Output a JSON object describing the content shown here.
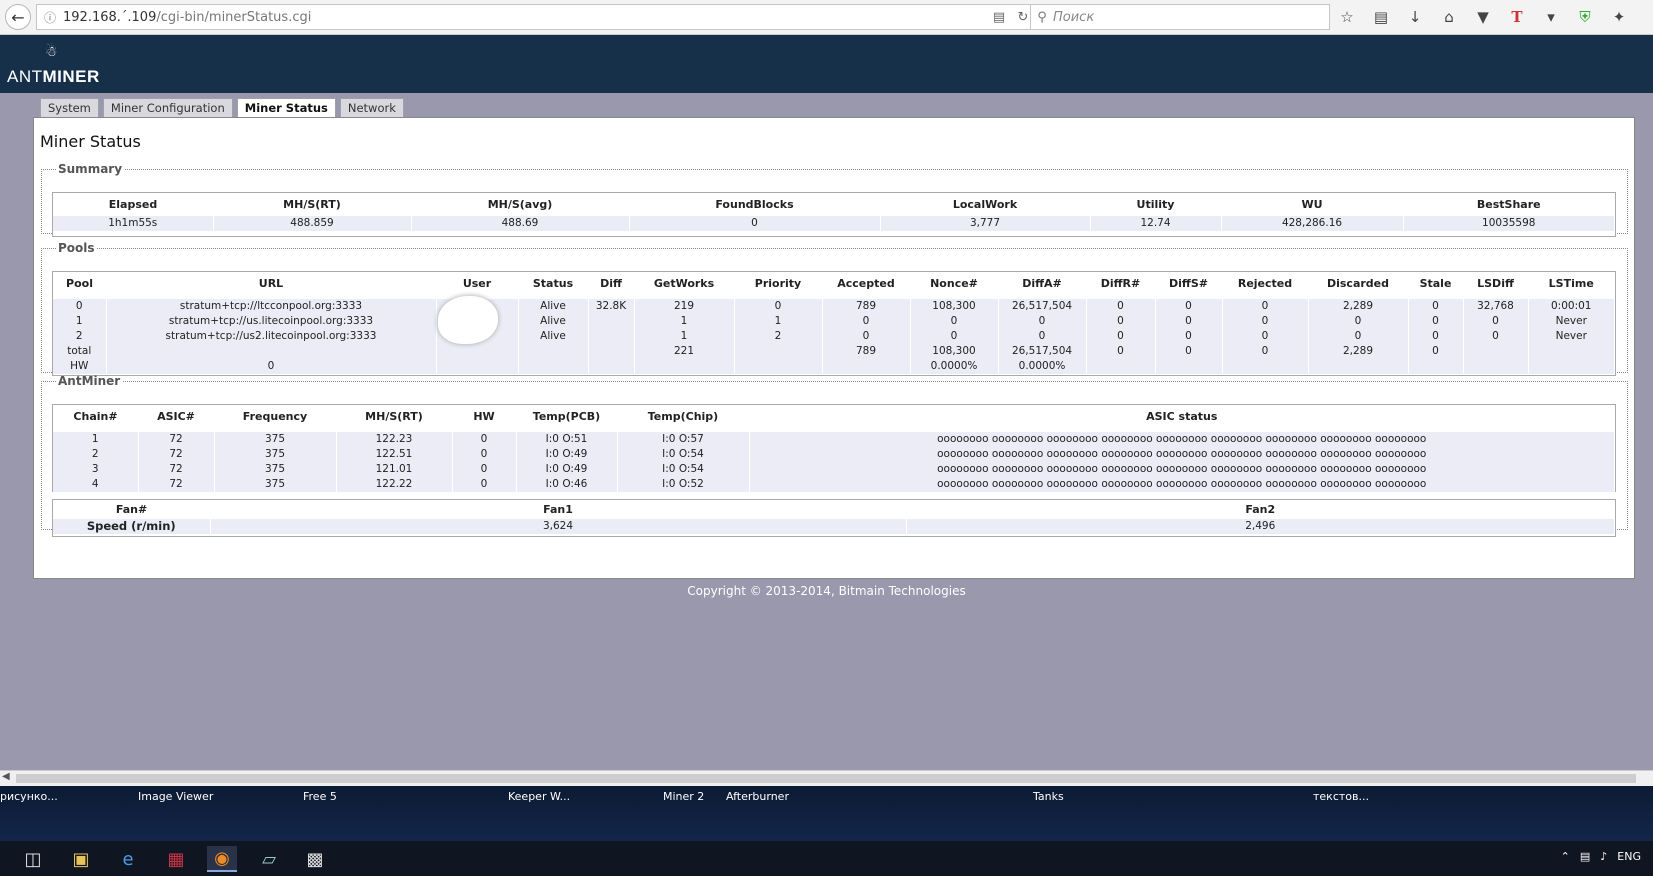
{
  "browser": {
    "url_host": "192.168.´.109",
    "url_path": "/cgi-bin/minerStatus.cgi",
    "search_placeholder": "Поиск"
  },
  "app": {
    "logo_prefix": "ANT",
    "logo_suffix": "MINER"
  },
  "tabs": [
    {
      "label": "System"
    },
    {
      "label": "Miner Configuration"
    },
    {
      "label": "Miner Status"
    },
    {
      "label": "Network"
    }
  ],
  "page_title": "Miner Status",
  "summary": {
    "legend": "Summary",
    "headers": [
      "Elapsed",
      "MH/S(RT)",
      "MH/S(avg)",
      "FoundBlocks",
      "LocalWork",
      "Utility",
      "WU",
      "BestShare"
    ],
    "row": [
      "1h1m55s",
      "488.859",
      "488.69",
      "0",
      "3,777",
      "12.74",
      "428,286.16",
      "10035598"
    ]
  },
  "pools": {
    "legend": "Pools",
    "headers": [
      "Pool",
      "URL",
      "User",
      "Status",
      "Diff",
      "GetWorks",
      "Priority",
      "Accepted",
      "Nonce#",
      "DiffA#",
      "DiffR#",
      "DiffS#",
      "Rejected",
      "Discarded",
      "Stale",
      "LSDiff",
      "LSTime"
    ],
    "rows": [
      [
        "0",
        "stratum+tcp://ltcconpool.org:3333",
        "",
        "Alive",
        "32.8K",
        "219",
        "0",
        "789",
        "108,300",
        "26,517,504",
        "0",
        "0",
        "0",
        "2,289",
        "0",
        "32,768",
        "0:00:01"
      ],
      [
        "1",
        "stratum+tcp://us.litecoinpool.org:3333",
        "",
        "Alive",
        "",
        "1",
        "1",
        "0",
        "0",
        "0",
        "0",
        "0",
        "0",
        "0",
        "0",
        "0",
        "Never"
      ],
      [
        "2",
        "stratum+tcp://us2.litecoinpool.org:3333",
        "",
        "Alive",
        "",
        "1",
        "2",
        "0",
        "0",
        "0",
        "0",
        "0",
        "0",
        "0",
        "0",
        "0",
        "Never"
      ],
      [
        "total",
        "",
        "",
        "",
        "",
        "221",
        "",
        "789",
        "108,300",
        "26,517,504",
        "0",
        "0",
        "0",
        "2,289",
        "0",
        "",
        ""
      ],
      [
        "HW",
        "0",
        "",
        "",
        "",
        "",
        "",
        "",
        "0.0000%",
        "0.0000%",
        "",
        "",
        "",
        "",
        "",
        "",
        ""
      ]
    ]
  },
  "antminer": {
    "legend": "AntMiner",
    "headers": [
      "Chain#",
      "ASIC#",
      "Frequency",
      "MH/S(RT)",
      "HW",
      "Temp(PCB)",
      "Temp(Chip)",
      "ASIC status"
    ],
    "rows": [
      [
        "1",
        "72",
        "375",
        "122.23",
        "0",
        "I:0 O:51",
        "I:0 O:57",
        "oooooooo oooooooo oooooooo oooooooo oooooooo oooooooo oooooooo oooooooo oooooooo"
      ],
      [
        "2",
        "72",
        "375",
        "122.51",
        "0",
        "I:0 O:49",
        "I:0 O:54",
        "oooooooo oooooooo oooooooo oooooooo oooooooo oooooooo oooooooo oooooooo oooooooo"
      ],
      [
        "3",
        "72",
        "375",
        "121.01",
        "0",
        "I:0 O:49",
        "I:0 O:54",
        "oooooooo oooooooo oooooooo oooooooo oooooooo oooooooo oooooooo oooooooo oooooooo"
      ],
      [
        "4",
        "72",
        "375",
        "122.22",
        "0",
        "I:0 O:46",
        "I:0 O:52",
        "oooooooo oooooooo oooooooo oooooooo oooooooo oooooooo oooooooo oooooooo oooooooo"
      ]
    ],
    "fan_headers": [
      "Fan#",
      "Fan1",
      "Fan2"
    ],
    "fan_row": [
      "Speed (r/min)",
      "3,624",
      "2,496"
    ]
  },
  "copyright": "Copyright © 2013-2014, Bitmain Technologies",
  "desktop_labels": [
    "рисунко...",
    "Image Viewer",
    "Free 5",
    "Keeper W...",
    "Miner 2",
    "Afterburner",
    "Tanks",
    "текстов..."
  ],
  "tray": {
    "lang": "ENG"
  }
}
